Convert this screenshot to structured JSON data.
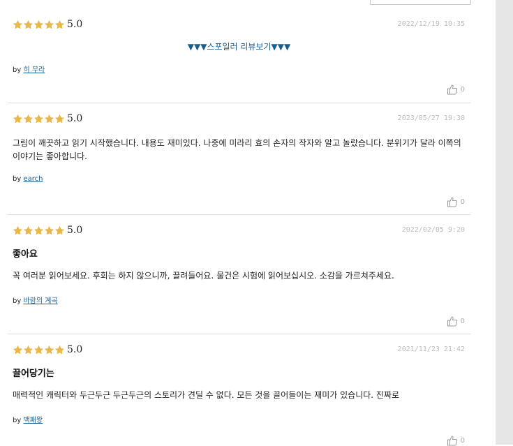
{
  "reviews": [
    {
      "rating": "5.0",
      "date": "2022/12/19 10:35",
      "spoiler_label": "▼▼▼스포일러 리뷰보기▼▼▼",
      "title": "",
      "body": "",
      "by_label": "by",
      "author": "히 무라",
      "likes": "0"
    },
    {
      "rating": "5.0",
      "date": "2023/05/27 19:30",
      "spoiler_label": "",
      "title": "",
      "body": "그림이 깨끗하고 읽기 시작했습니다. 내용도 재미있다. 나중에 미라리 효의 손자의 작자와 알고 놀랐습니다. 분위기가 달라 이쪽의 이야기는 좋아합니다.",
      "by_label": "by",
      "author": "earch",
      "likes": "0"
    },
    {
      "rating": "5.0",
      "date": "2022/02/05 9:20",
      "spoiler_label": "",
      "title": "좋아요",
      "body": "꼭 여러분 읽어보세요. 후회는 하지 않으니까, 끌려들어요. 물건은 시험에 읽어보십시오. 소감을 가르쳐주세요.",
      "by_label": "by",
      "author": "바람의 계곡",
      "likes": "0"
    },
    {
      "rating": "5.0",
      "date": "2021/11/23 21:42",
      "spoiler_label": "",
      "title": "끌어당기는",
      "body": "매력적인 캐릭터와 두근두근 두근두근의 스토리가 견딜 수 없다. 모든 것을 끌어들이는 재미가 있습니다. 진짜로",
      "by_label": "by",
      "author": "백패왕",
      "likes": "0"
    }
  ],
  "colors": {
    "star": "#e8b84a",
    "link": "#1b5f8f",
    "date": "#bdbdbd",
    "divider": "#dcdcdc",
    "gutter": "#e6e6e6"
  },
  "icons": {
    "rating": "star-icon",
    "like": "thumbs-up-icon"
  }
}
